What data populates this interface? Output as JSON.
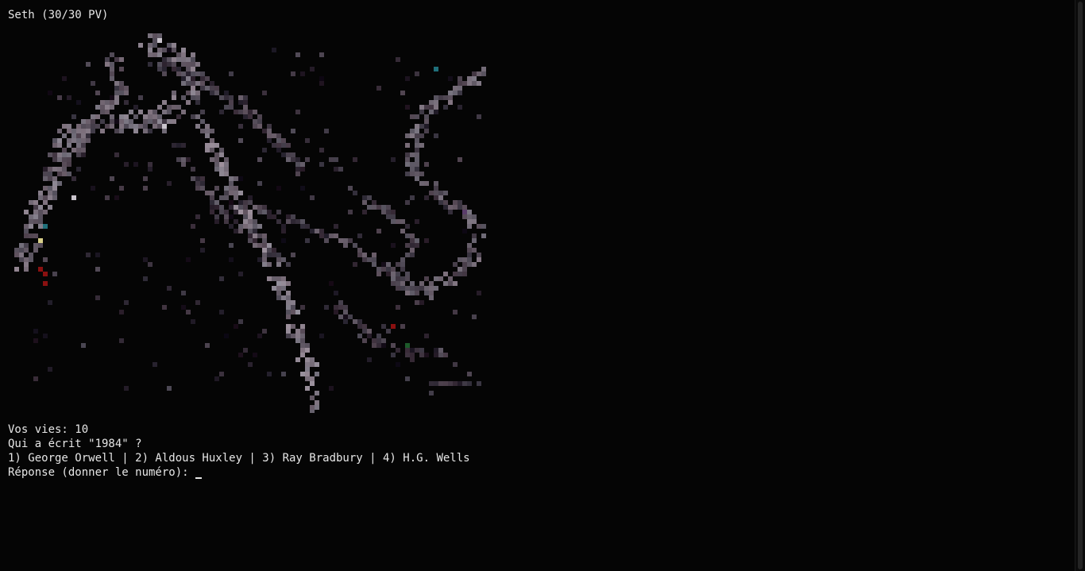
{
  "window": {
    "header": "Seth (30/30 PV)"
  },
  "game": {
    "lives_text": "Vos vies: 10",
    "question": "Qui a écrit \"1984\" ?",
    "options_text": "1) George Orwell | 2) Aldous Huxley | 3) Ray Bradbury | 4) H.G. Wells",
    "prompt": "Réponse (donner le numéro): "
  },
  "creature_art": {
    "icon": "pixel-dragon-icon",
    "palette": {
      "gray": "#6f6a74",
      "light": "#c9c4cc",
      "red": "#8a1010",
      "teal": "#1f6f7a",
      "yellow": "#d9d08a"
    }
  }
}
